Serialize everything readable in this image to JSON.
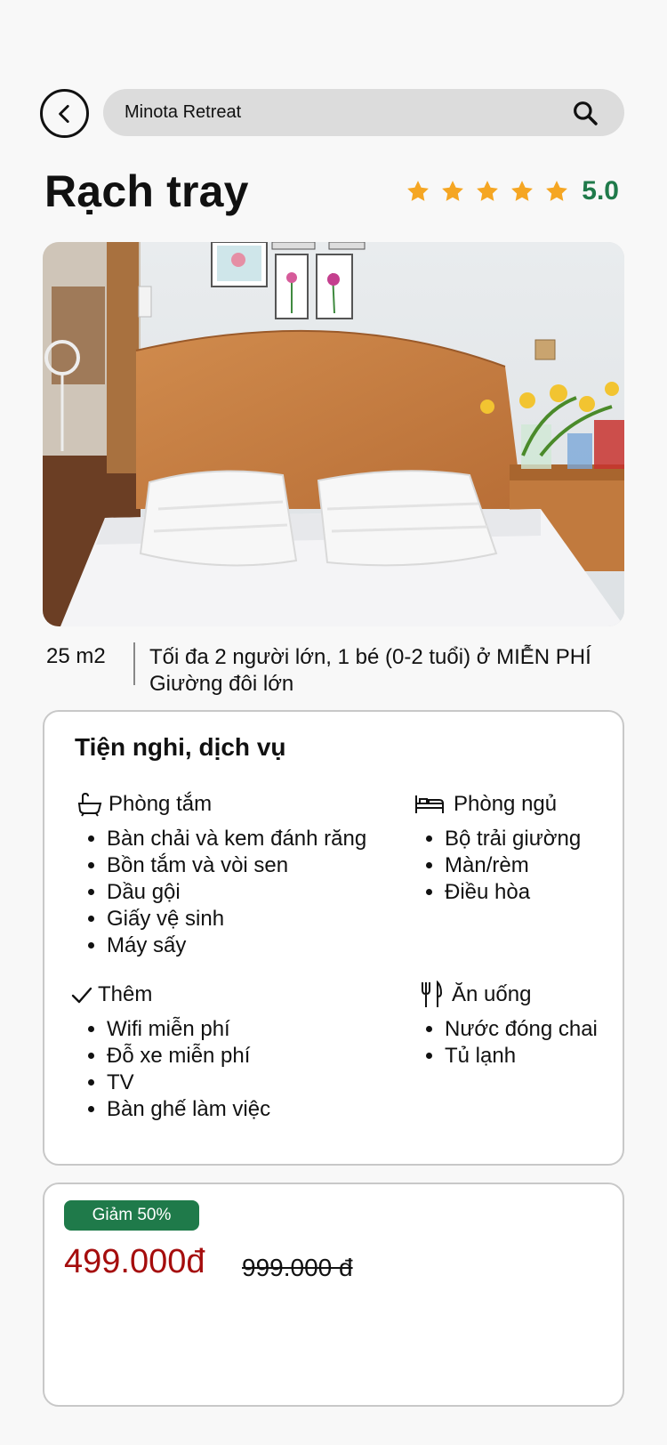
{
  "header": {
    "back_label": "back",
    "search_value": "Minota Retreat"
  },
  "room": {
    "title": "Rạch tray",
    "rating_value": "5.0",
    "rating_stars": 5,
    "size": "25 m2",
    "occupancy": "Tối đa 2 người lớn, 1 bé (0-2 tuổi) ở MIỄN PHÍ",
    "bed": "Giường đôi lớn"
  },
  "amenities": {
    "title": "Tiện nghi, dịch vụ",
    "bathroom": {
      "label": "Phòng tắm",
      "items": [
        "Bàn chải và kem đánh răng",
        "Bồn tắm và vòi sen",
        "Dầu gội",
        "Giấy vệ sinh",
        "Máy sấy"
      ]
    },
    "bedroom": {
      "label": "Phòng ngủ",
      "items": [
        "Bộ trải giường",
        "Màn/rèm",
        "Điều hòa"
      ]
    },
    "extra": {
      "label": "Thêm",
      "items": [
        "Wifi miễn phí",
        "Đỗ xe miễn phí",
        "TV",
        "Bàn ghế làm việc"
      ]
    },
    "dining": {
      "label": "Ăn uống",
      "items": [
        "Nước đóng chai",
        "Tủ lạnh"
      ]
    }
  },
  "price": {
    "discount": "Giảm 50%",
    "new_price": "499.000đ",
    "old_price": "999.000 đ"
  },
  "colors": {
    "accent_green": "#1f7a4a",
    "star": "#f5a623",
    "price_red": "#a50d0d"
  },
  "icons": [
    "chevron-left-icon",
    "search-icon",
    "star-icon",
    "bathtub-icon",
    "bed-icon",
    "check-icon",
    "utensils-icon"
  ]
}
